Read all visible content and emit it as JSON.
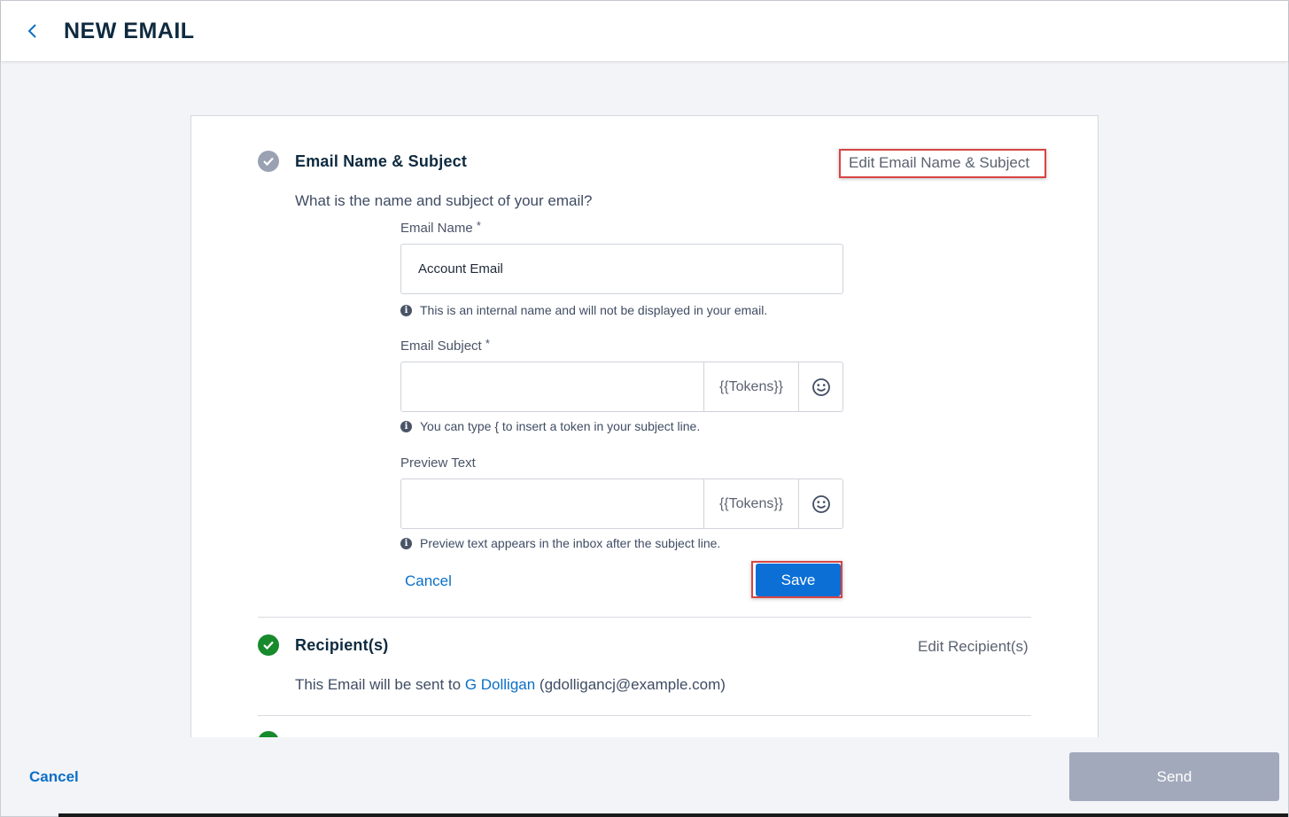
{
  "header": {
    "title": "NEW EMAIL",
    "back_icon": "chevron-left-icon"
  },
  "steps": {
    "name_subject": {
      "title": "Email Name & Subject",
      "edit_label": "Edit Email Name & Subject",
      "question": "What is the name and subject of your email?",
      "email_name": {
        "label": "Email Name",
        "required_mark": "*",
        "value": "Account Email",
        "hint": "This is an internal name and will not be displayed in your email."
      },
      "email_subject": {
        "label": "Email Subject",
        "required_mark": "*",
        "value": "",
        "tokens_label": "{{Tokens}}",
        "hint": "You can type { to insert a token in your subject line."
      },
      "preview_text": {
        "label": "Preview Text",
        "value": "",
        "tokens_label": "{{Tokens}}",
        "hint": "Preview text appears in the inbox after the subject line."
      },
      "cancel_label": "Cancel",
      "save_label": "Save"
    },
    "recipients": {
      "title": "Recipient(s)",
      "edit_label": "Edit Recipient(s)",
      "sentence_prefix": "This Email will be sent to",
      "recipient_name": "G Dolligan",
      "recipient_email": "(gdolligancj@example.com)"
    }
  },
  "footer": {
    "cancel_label": "Cancel",
    "send_label": "Send"
  },
  "colors": {
    "accent": "#0b6fd6",
    "link": "#0b6fc7",
    "success": "#178a2c",
    "disabled_button": "#a2a9bb",
    "highlight": "#d64545"
  }
}
